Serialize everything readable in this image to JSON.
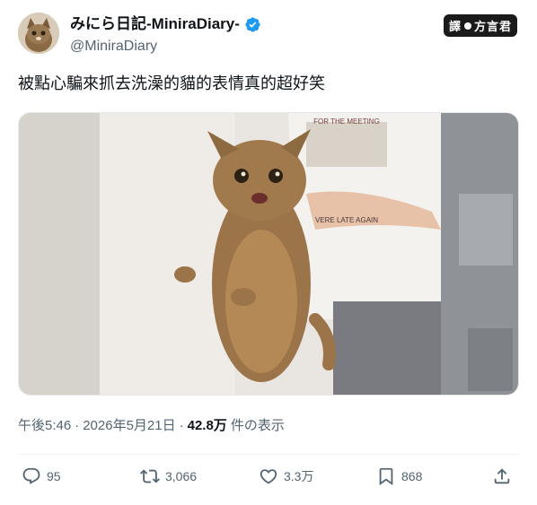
{
  "author": {
    "display_name": "みにら日記-MiniraDiary-",
    "handle": "@MiniraDiary",
    "verified_icon": "verified-badge-icon",
    "accent_color": "#1d9bf0"
  },
  "watermark": {
    "left": "譯",
    "right": "方言君"
  },
  "tweet": {
    "text": "被點心騙來抓去洗澡的貓的表情真的超好笑"
  },
  "media": {
    "shirt_text_top": "FOR THE MEETING",
    "shirt_text_bottom": "VERE LATE AGAIN"
  },
  "meta": {
    "time": "午後5:46",
    "separator": "·",
    "date": "2026年5月21日",
    "separator2": "·",
    "views": "42.8万",
    "views_label": "件の表示"
  },
  "actions": {
    "reply": {
      "icon": "reply-icon",
      "count": "95"
    },
    "retweet": {
      "icon": "retweet-icon",
      "count": "3,066"
    },
    "like": {
      "icon": "heart-icon",
      "count": "3.3万"
    },
    "bookmark": {
      "icon": "bookmark-icon",
      "count": "868"
    },
    "share": {
      "icon": "share-icon"
    }
  }
}
